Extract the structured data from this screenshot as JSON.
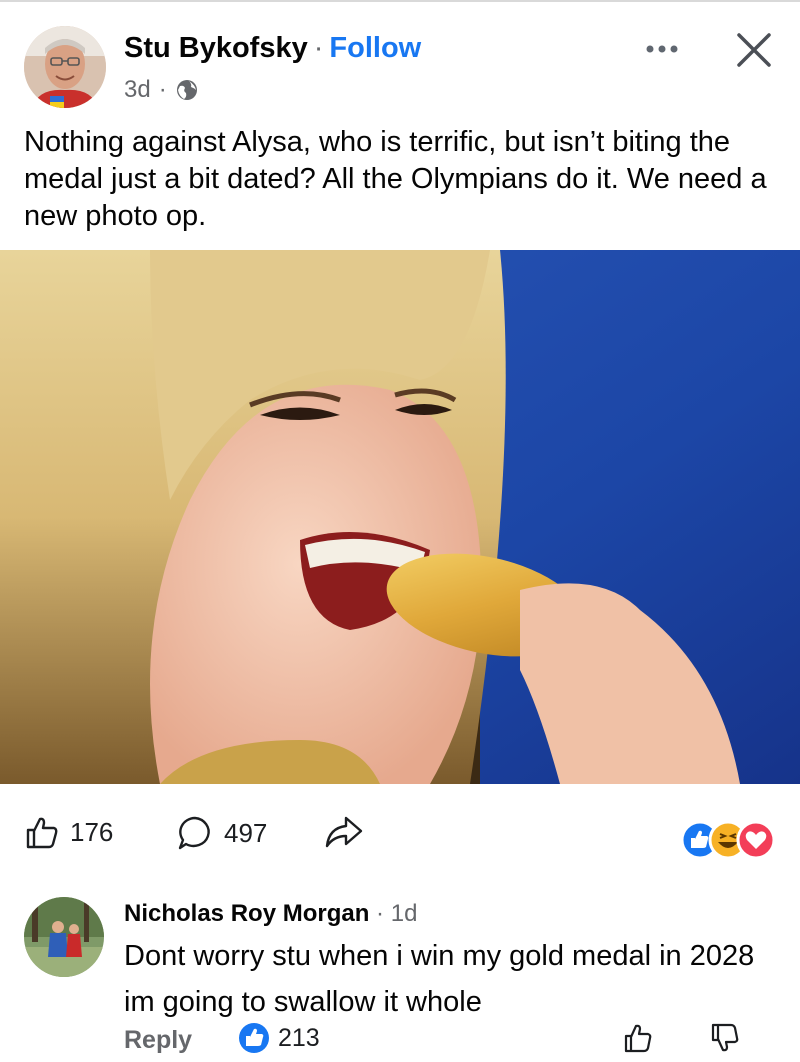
{
  "post": {
    "author": "Stu Bykofsky",
    "separator": "·",
    "follow_label": "Follow",
    "timestamp": "3d",
    "meta_separator": "·",
    "text": "Nothing against Alysa, who is terrific, but isn’t biting the medal just a bit dated? All the Olympians do it. We need a new photo op."
  },
  "actions": {
    "like_count": "176",
    "comment_count": "497"
  },
  "comment": {
    "author": "Nicholas Roy Morgan",
    "separator": "·",
    "time": "1d",
    "text": "Dont worry stu when i win my gold medal in 2028 im going to swallow it whole",
    "reply_label": "Reply",
    "like_count": "213"
  },
  "icons": {
    "more": "ellipsis-icon",
    "close": "close-icon",
    "privacy": "globe-icon",
    "like": "thumbs-up-icon",
    "comment": "speech-bubble-icon",
    "share": "share-arrow-icon",
    "reactions": [
      "like-reaction-icon",
      "haha-reaction-icon",
      "love-reaction-icon"
    ],
    "comment_like": "thumbs-up-icon",
    "comment_dislike": "thumbs-down-icon"
  },
  "colors": {
    "accent": "#1877f2",
    "secondary_text": "#65676b",
    "love": "#f33e58",
    "haha": "#f7b125"
  }
}
